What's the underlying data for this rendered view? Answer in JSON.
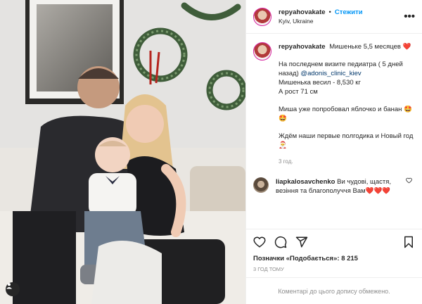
{
  "header": {
    "username": "repyahovakate",
    "separator": "•",
    "follow_label": "Стежити",
    "location": "Kyiv, Ukraine"
  },
  "caption": {
    "username": "repyahovakate",
    "title": "Мишеньке 5,5 месяцев ❤️",
    "line1": "На последнем визите педиатра ( 5 дней назад) ",
    "mention": "@adonis_clinic_kiev",
    "line2": "Мишенька весил - 8,530 кг",
    "line3": "А рост 71 см",
    "para2": "Миша уже попробовал яблочко и банан 🤩🤩",
    "para3": "Ждём наши первые полгодика и Новый год 🎅",
    "time": "3 год."
  },
  "comment": {
    "username": "liapkalosavchenko",
    "text": "Ви чудові, щастя, везіння та благополуччя Вам❤️❤️❤️"
  },
  "likes_text": "Позначки «Подобається»: 8 215",
  "post_time": "3 ГОД ТОМУ",
  "comments_disabled": "Коментарі до цього допису обмежено.",
  "icons": {
    "like": "heart-icon",
    "comment": "comment-icon",
    "share": "share-icon",
    "save": "bookmark-icon",
    "more": "more-icon",
    "tagged": "user-tag-icon"
  }
}
